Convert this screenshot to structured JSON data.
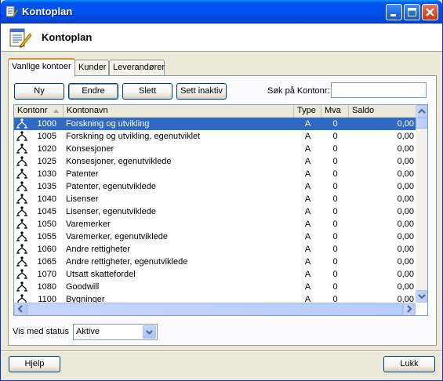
{
  "window": {
    "title": "Kontoplan"
  },
  "header": {
    "title": "Kontoplan"
  },
  "tabs": [
    {
      "label": "Vanlige kontoer",
      "active": true
    },
    {
      "label": "Kunder",
      "active": false
    },
    {
      "label": "Leverandører",
      "active": false
    }
  ],
  "toolbar": {
    "new_label": "Ny",
    "edit_label": "Endre",
    "delete_label": "Slett",
    "inactive_label": "Sett inaktiv"
  },
  "search": {
    "label": "Søk på Kontonr:",
    "value": ""
  },
  "table": {
    "columns": [
      "Kontonr",
      "Kontonavn",
      "Type",
      "Mva",
      "Saldo"
    ],
    "rows": [
      {
        "nr": "1000",
        "name": "Forskning og utvikling",
        "type": "A",
        "mva": "0",
        "saldo": "0,00",
        "selected": true
      },
      {
        "nr": "1005",
        "name": "Forskning og utvikling, egenutviklet",
        "type": "A",
        "mva": "0",
        "saldo": "0,00"
      },
      {
        "nr": "1020",
        "name": "Konsesjoner",
        "type": "A",
        "mva": "0",
        "saldo": "0,00"
      },
      {
        "nr": "1025",
        "name": "Konsesjoner, egenutviklede",
        "type": "A",
        "mva": "0",
        "saldo": "0,00"
      },
      {
        "nr": "1030",
        "name": "Patenter",
        "type": "A",
        "mva": "0",
        "saldo": "0,00"
      },
      {
        "nr": "1035",
        "name": "Patenter, egenutviklede",
        "type": "A",
        "mva": "0",
        "saldo": "0,00"
      },
      {
        "nr": "1040",
        "name": "Lisenser",
        "type": "A",
        "mva": "0",
        "saldo": "0,00"
      },
      {
        "nr": "1045",
        "name": "Lisenser, egenutviklede",
        "type": "A",
        "mva": "0",
        "saldo": "0,00"
      },
      {
        "nr": "1050",
        "name": "Varemerker",
        "type": "A",
        "mva": "0",
        "saldo": "0,00"
      },
      {
        "nr": "1055",
        "name": "Varemerker, egenutviklede",
        "type": "A",
        "mva": "0",
        "saldo": "0,00"
      },
      {
        "nr": "1060",
        "name": "Andre rettigheter",
        "type": "A",
        "mva": "0",
        "saldo": "0,00"
      },
      {
        "nr": "1065",
        "name": "Andre rettigheter, egenutviklede",
        "type": "A",
        "mva": "0",
        "saldo": "0,00"
      },
      {
        "nr": "1070",
        "name": "Utsatt skattefordel",
        "type": "A",
        "mva": "0",
        "saldo": "0,00"
      },
      {
        "nr": "1080",
        "name": "Goodwill",
        "type": "A",
        "mva": "0",
        "saldo": "0,00"
      },
      {
        "nr": "1100",
        "name": "Bygninger",
        "type": "A",
        "mva": "0",
        "saldo": "0,00"
      }
    ]
  },
  "status_filter": {
    "label": "Vis med status",
    "value": "Aktive"
  },
  "footer": {
    "help_label": "Hjelp",
    "close_label": "Lukk"
  },
  "icons": {
    "row_icon": "account-node-icon",
    "sort": "sort-ascending-icon",
    "title": "kontoplan-app-icon",
    "header": "notepad-pencil-icon"
  },
  "colors": {
    "titlebar": "#0054e3",
    "selection": "#316ac5",
    "face": "#ece9d8",
    "active_tab_accent": "#e68b2c"
  }
}
